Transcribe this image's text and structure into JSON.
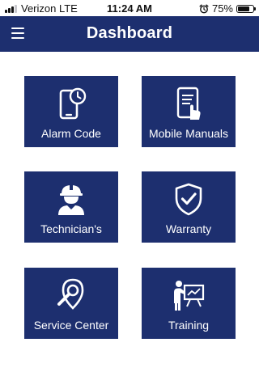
{
  "status_bar": {
    "carrier": "Verizon LTE",
    "time": "11:24 AM",
    "battery_percent": "75%",
    "battery_level": 0.75,
    "signal_bars": 3,
    "alarm_icon": "alarm-clock-icon"
  },
  "header": {
    "title": "Dashboard",
    "menu_icon": "hamburger-menu-icon",
    "background": "#1d2f6f"
  },
  "tiles": [
    {
      "label": "Alarm Code",
      "icon": "phone-clock-icon"
    },
    {
      "label": "Mobile Manuals",
      "icon": "tablet-touch-icon"
    },
    {
      "label": "Technician's",
      "icon": "technician-icon"
    },
    {
      "label": "Warranty",
      "icon": "shield-check-icon"
    },
    {
      "label": "Service Center",
      "icon": "location-search-icon"
    },
    {
      "label": "Training",
      "icon": "presentation-icon"
    }
  ],
  "colors": {
    "tile_background": "#1d2f6f",
    "tile_text": "#ffffff",
    "page_background": "#ffffff"
  }
}
